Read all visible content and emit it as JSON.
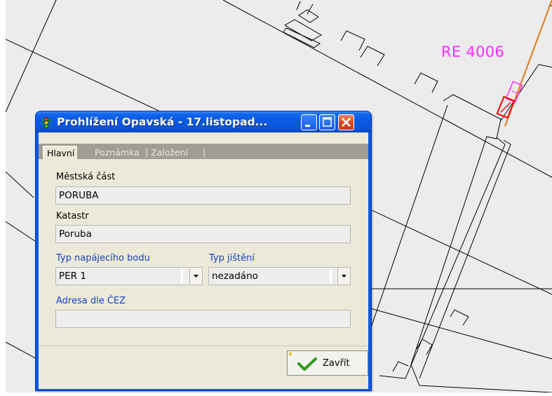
{
  "map": {
    "label": "RE 4006",
    "label_color": "#ff2bff"
  },
  "window": {
    "title": "Prohlížení Opavská - 17.listopad...",
    "icon": "traffic-light-icon",
    "controls": [
      "minimize-icon",
      "maximize-icon",
      "close-icon"
    ]
  },
  "tabs": [
    {
      "label": "Hlavní",
      "active": true
    },
    {
      "label": "Poznámka",
      "active": false
    },
    {
      "label": "Založení",
      "active": false
    }
  ],
  "tab_separator": "|",
  "form": {
    "mestska_cast": {
      "label": "Městská část",
      "value": "PORUBA"
    },
    "katastr": {
      "label": "Katastr",
      "value": "Poruba"
    },
    "typ_napajeciho_bodu": {
      "label": "Typ napájecího bodu",
      "value": "PER 1"
    },
    "typ_jisteni": {
      "label": "Typ jištění",
      "value": "nezadáno"
    },
    "adresa_dle_cez": {
      "label": "Adresa dle ČEZ",
      "value": ""
    }
  },
  "buttons": {
    "close_label": "Zavřít",
    "close_icon": "checkmark-icon"
  },
  "colors": {
    "titlebar": "#0a5ae4",
    "client_bg": "#ece9d8",
    "blue_label": "#1542c4",
    "check_green": "#2e9a1e"
  }
}
